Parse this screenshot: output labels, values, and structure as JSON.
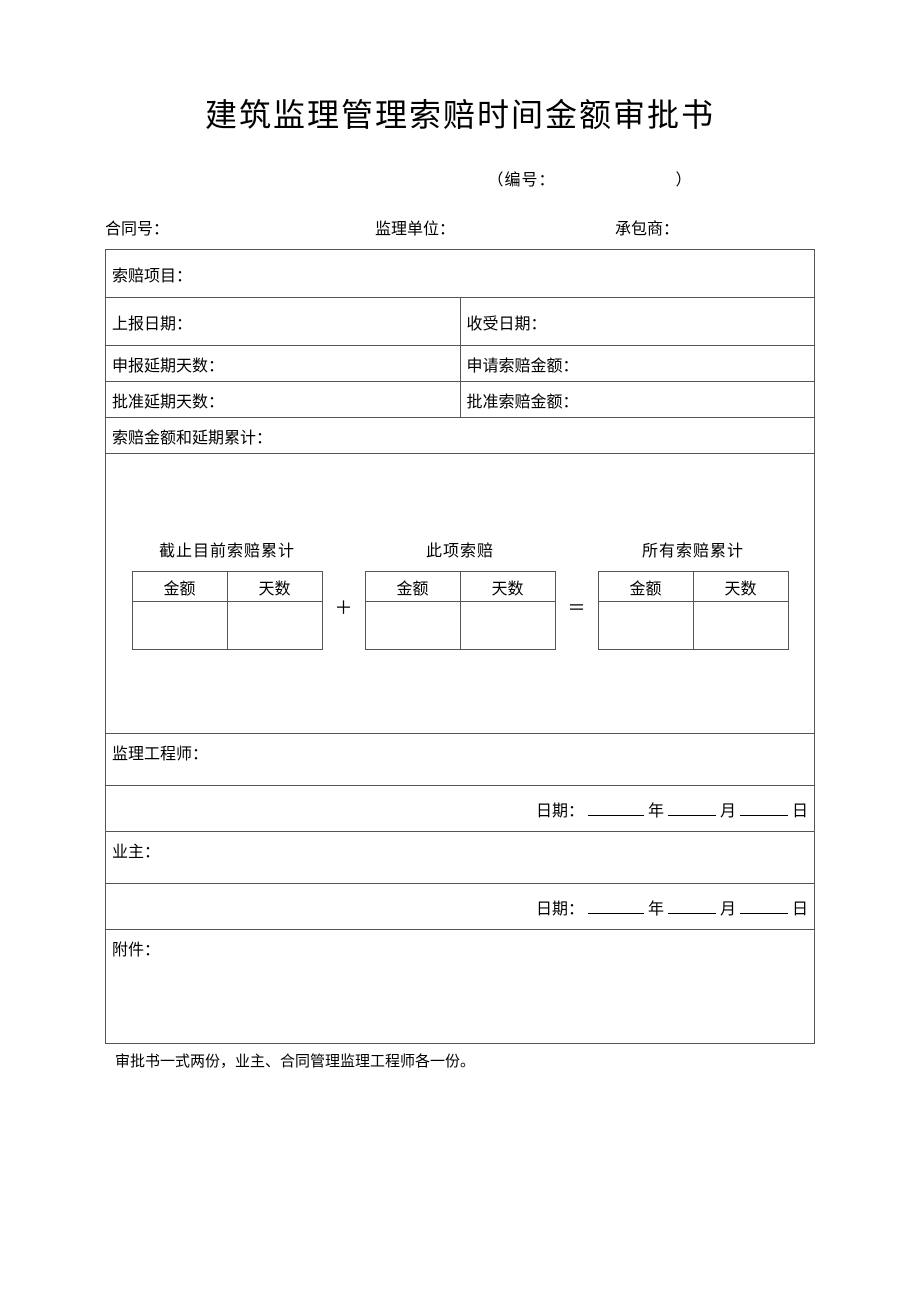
{
  "title": "建筑监理管理索赔时间金额审批书",
  "bianhao_prefix": "（编号：",
  "bianhao_suffix": "）",
  "header": {
    "contract_no_label": "合同号：",
    "supervisor_label": "监理单位：",
    "contractor_label": "承包商："
  },
  "rows": {
    "claim_item_label": "索赔项目：",
    "report_date_label": "上报日期：",
    "receive_date_label": "收受日期：",
    "apply_delay_days_label": "申报延期天数：",
    "apply_claim_amount_label": "申请索赔金额：",
    "approve_delay_days_label": "批准延期天数：",
    "approve_claim_amount_label": "批准索赔金额：",
    "cumulative_label": "索赔金额和延期累计：",
    "supervising_engineer_label": "监理工程师：",
    "owner_label": "业主：",
    "attachment_label": "附件：",
    "date_label": "日期：",
    "year": "年",
    "month": "月",
    "day": "日"
  },
  "calc": {
    "prev_total_caption": "截止目前索赔累计",
    "this_claim_caption": "此项索赔",
    "all_total_caption": "所有索赔累计",
    "amount": "金额",
    "days": "天数",
    "plus": "＋",
    "equals": "＝"
  },
  "note": "审批书一式两份，业主、合同管理监理工程师各一份。"
}
